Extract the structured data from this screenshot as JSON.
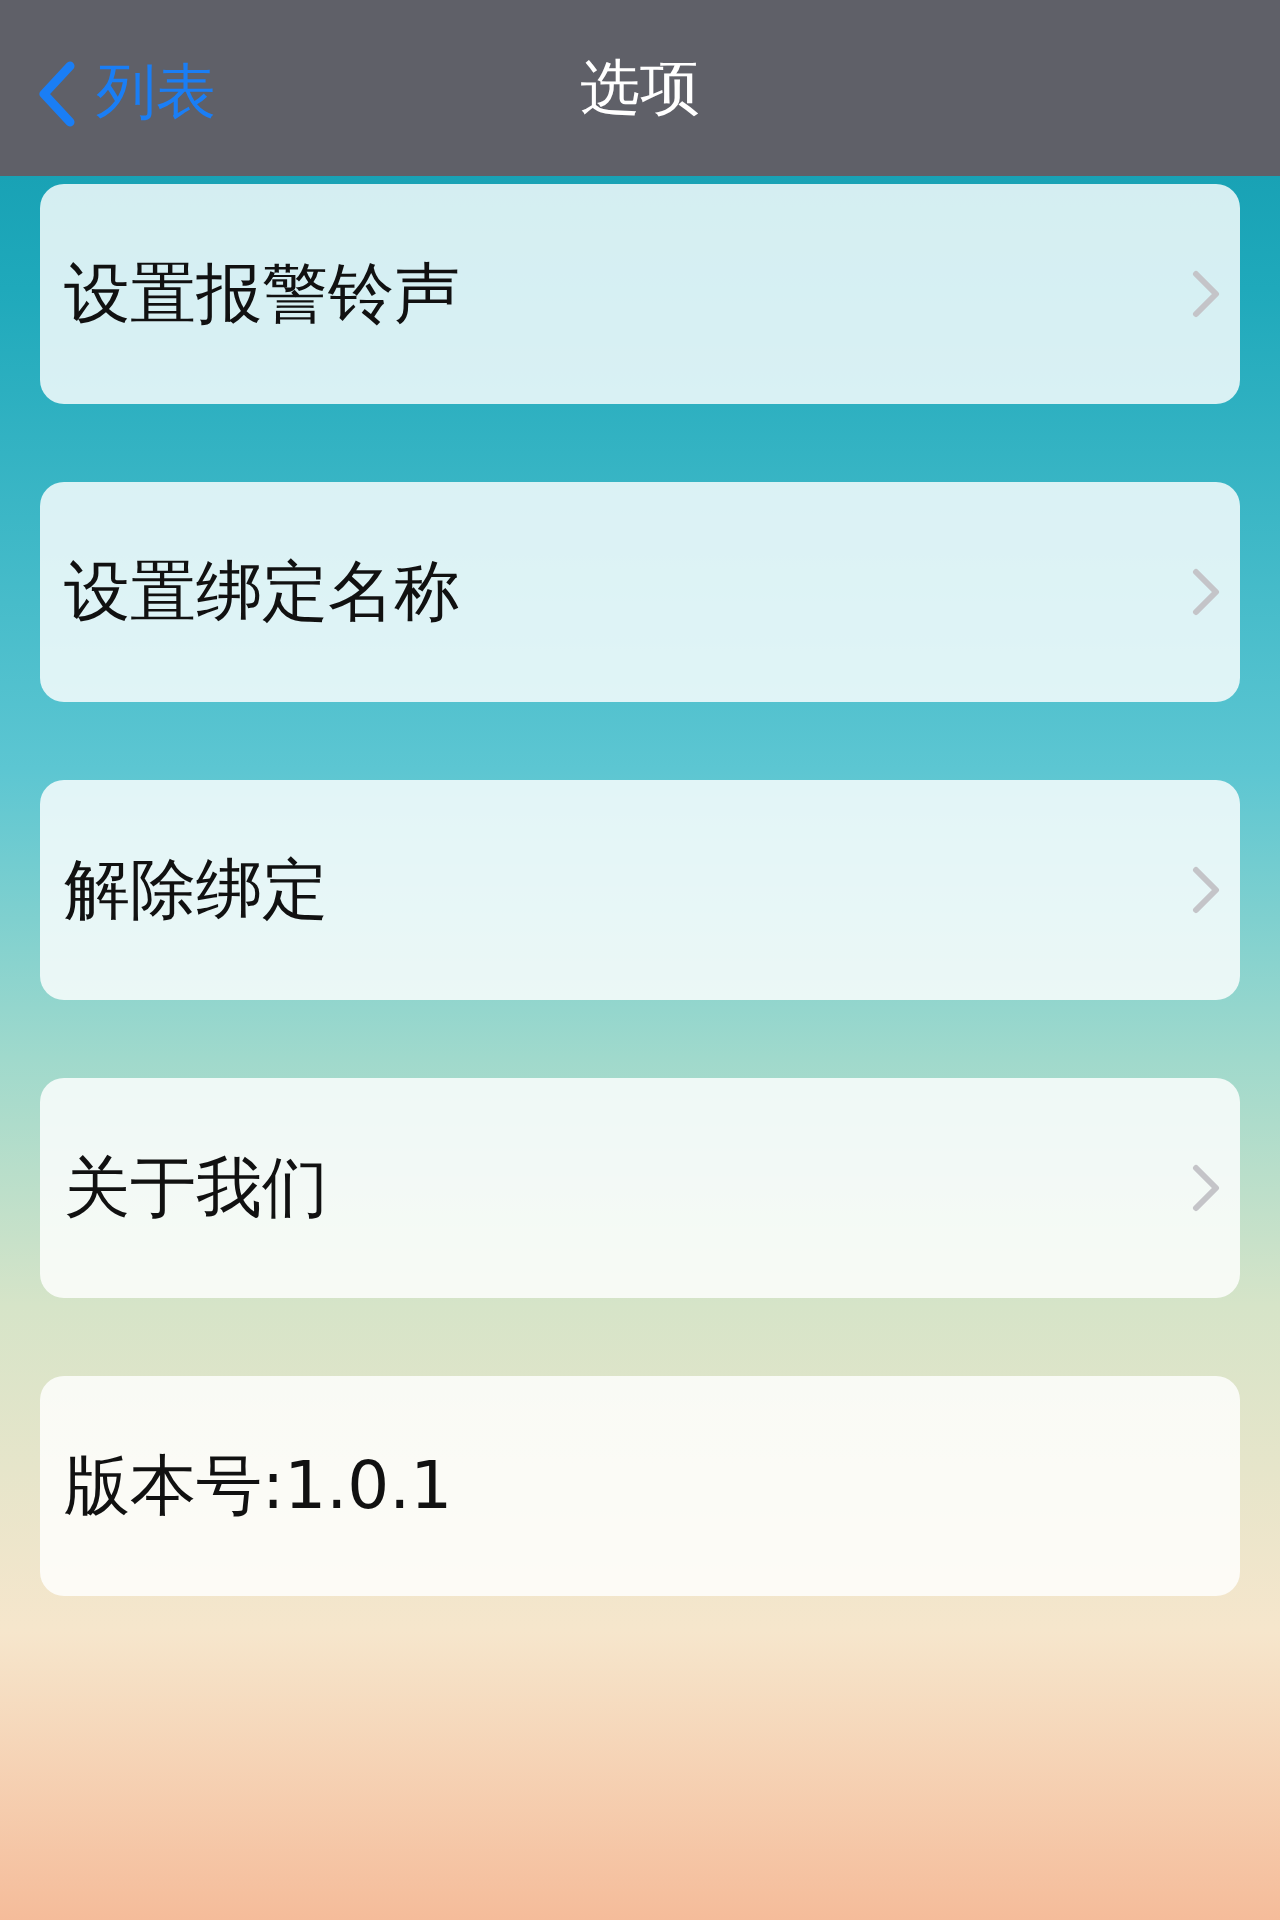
{
  "nav_bar": {
    "back": "列表",
    "title": "选项"
  },
  "items": [
    {
      "kind": "link",
      "label": "设置报警铃声"
    },
    {
      "kind": "link",
      "label": "设置绑定名称"
    },
    {
      "kind": "link",
      "label": "解除绑定"
    },
    {
      "kind": "link",
      "label": "关于我们"
    },
    {
      "kind": "info",
      "label": "版本号:1.0.1"
    }
  ]
}
